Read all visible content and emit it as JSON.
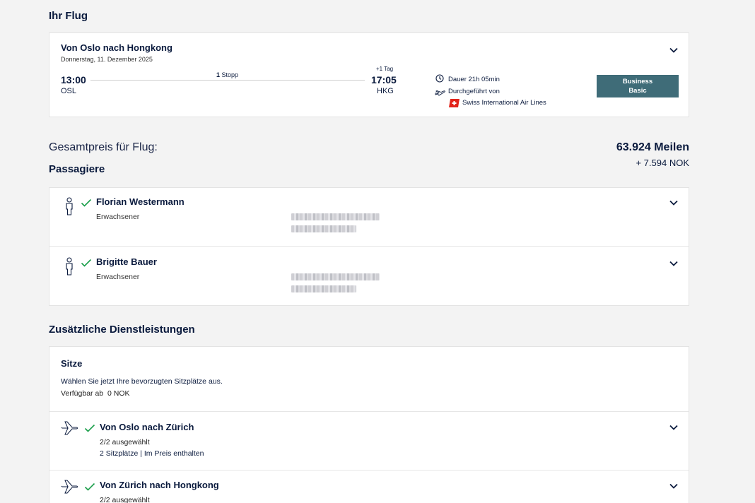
{
  "flight_section": {
    "heading": "Ihr Flug",
    "route_title": "Von Oslo nach Hongkong",
    "date": "Donnerstag, 11. Dezember 2025",
    "departure_time": "13:00",
    "departure_code": "OSL",
    "stops_count": "1",
    "stops_label": "Stopp",
    "day_offset": "+1 Tag",
    "arrival_time": "17:05",
    "arrival_code": "HKG",
    "duration": "Dauer 21h 05min",
    "operated_by_label": "Durchgeführt von",
    "airline": "Swiss International Air Lines",
    "fare_line1": "Business",
    "fare_line2": "Basic",
    "fare_color": "#3f6c78"
  },
  "total": {
    "label": "Gesamtpreis für Flug:",
    "miles": "63.924 Meilen",
    "cash": "+ 7.594 NOK"
  },
  "passengers": {
    "heading": "Passagiere",
    "items": [
      {
        "name": "Florian Westermann",
        "type": "Erwachsener"
      },
      {
        "name": "Brigitte Bauer",
        "type": "Erwachsener"
      }
    ]
  },
  "services": {
    "heading": "Zusätzliche Dienstleistungen",
    "seats_title": "Sitze",
    "seats_prompt": "Wählen Sie jetzt Ihre bevorzugten Sitzplätze aus.",
    "seats_available_prefix": "Verfügbar ab",
    "seats_available_value": "0 NOK",
    "segments": [
      {
        "title": "Von Oslo nach Zürich",
        "status": "2/2 ausgewählt",
        "detail": "2 Sitzplätze | Im Preis enthalten"
      },
      {
        "title": "Von Zürich nach Hongkong",
        "status": "2/2 ausgewählt",
        "detail": ""
      }
    ]
  },
  "colors": {
    "check": "#1a9e4a",
    "text": "#0a1a3d",
    "swiss_red": "#e2231a"
  }
}
